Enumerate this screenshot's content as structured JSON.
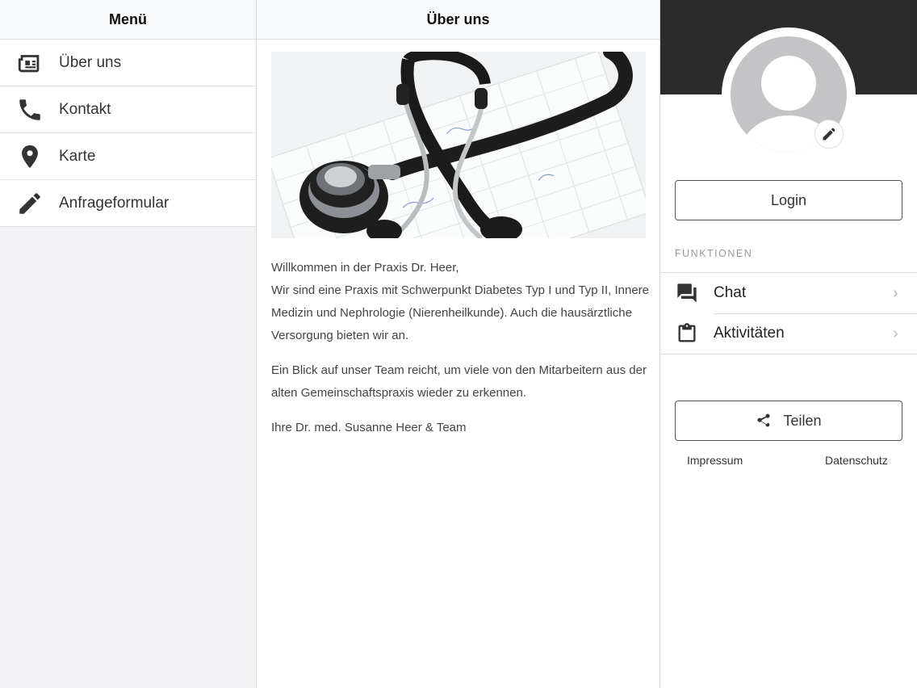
{
  "menu": {
    "title": "Menü",
    "items": [
      {
        "label": "Über uns",
        "icon": "newspaper-icon"
      },
      {
        "label": "Kontakt",
        "icon": "phone-icon"
      },
      {
        "label": "Karte",
        "icon": "map-pin-icon"
      },
      {
        "label": "Anfrageformular",
        "icon": "pencil-icon"
      }
    ]
  },
  "content": {
    "title": "Über uns",
    "paragraphs": [
      "Willkommen in der Praxis Dr. Heer,",
      "Wir sind eine Praxis mit Schwerpunkt Diabetes Typ I und Typ II, Innere Medizin und Nephrologie (Nierenheilkunde). Auch die hausärztliche Versorgung bieten wir an.",
      "Ein Blick auf unser Team reicht, um viele von den Mitarbeitern aus der alten Gemeinschaftspraxis wieder zu erkennen.",
      "Ihre Dr. med. Susanne Heer & Team"
    ]
  },
  "sidebar": {
    "login_label": "Login",
    "section_label": "FUNKTIONEN",
    "functions": [
      {
        "label": "Chat",
        "icon": "chat-icon"
      },
      {
        "label": "Aktivitäten",
        "icon": "clipboard-icon"
      }
    ],
    "share_label": "Teilen",
    "impressum_label": "Impressum",
    "datenschutz_label": "Datenschutz"
  }
}
